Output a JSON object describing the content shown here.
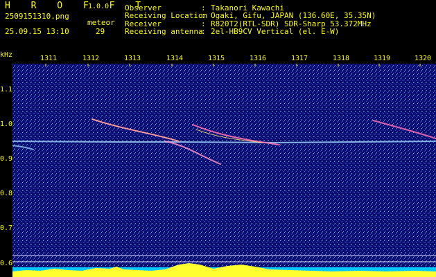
{
  "app": {
    "brand": "H R O F F T",
    "version": "1.0.0"
  },
  "file": {
    "name": "2509151310.png",
    "datetime": "25.09.15 13:10"
  },
  "meteor": {
    "label": "meteor",
    "count": "29"
  },
  "info": [
    {
      "key": "Observer",
      "sep": ":",
      "value": "Takanori Kawachi"
    },
    {
      "key": "Receiving Location",
      "sep": ":",
      "value": "Ogaki, Gifu, JAPAN (136.60E, 35.35N)"
    },
    {
      "key": "Receiver",
      "sep": ":",
      "value": "R820T2(RTL-SDR) SDR-Sharp 53.372MHz"
    },
    {
      "key": "Receiving antenna",
      "sep": ":",
      "value": "2el-HB9CV Vertical (el. E-W)"
    }
  ],
  "spectrogram": {
    "y_unit": "kHz",
    "y_ticks": [
      "1.1",
      "1.0",
      "0.9",
      "0.8",
      "0.7",
      "0.6"
    ],
    "x_ticks": [
      "1311",
      "1312",
      "1313",
      "1314",
      "1315",
      "1316",
      "1317",
      "1318",
      "1319",
      "1320"
    ],
    "colors": {
      "background": "#0a0a6a",
      "label": "#ffff00",
      "carrier": "#9fd8ff",
      "meteor": "#ff6fb0"
    }
  }
}
